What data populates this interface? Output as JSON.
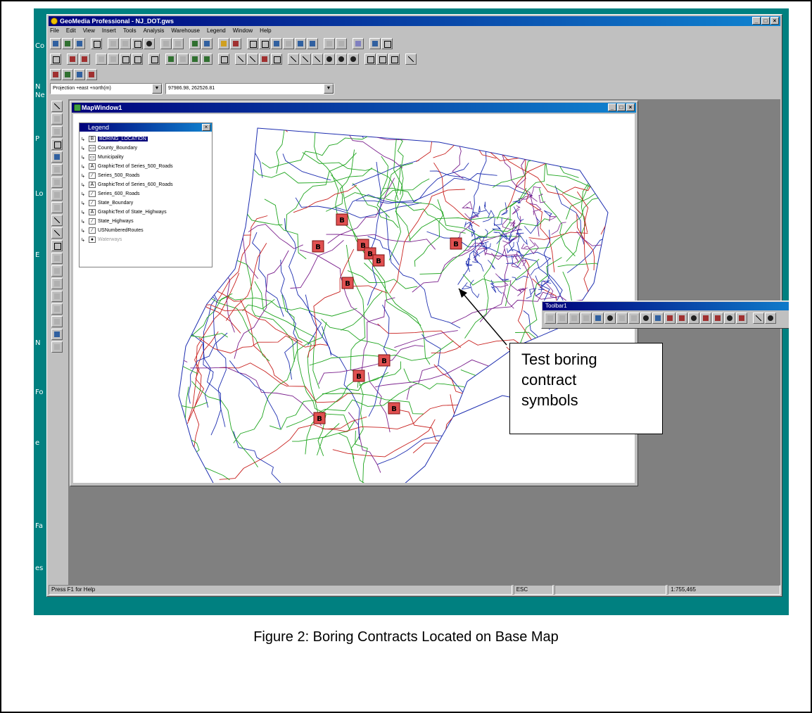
{
  "app": {
    "title": "GeoMedia Professional - NJ_DOT.gws",
    "menu": [
      "File",
      "Edit",
      "View",
      "Insert",
      "Tools",
      "Analysis",
      "Warehouse",
      "Legend",
      "Window",
      "Help"
    ],
    "projection_combo": "Projection +east +north(m)",
    "coordinate_combo": "97986.98, 262526.81",
    "status": {
      "help": "Press F1 for Help",
      "mode": "ESC",
      "scale": "1:755,465"
    }
  },
  "desktop_labels": [
    "Co",
    "N",
    "Ne",
    "P",
    "Lo",
    "E",
    "N",
    "Fo",
    "e",
    "Fa",
    "es"
  ],
  "map_window": {
    "title": "MapWindow1"
  },
  "legend": {
    "title": "Legend",
    "items": [
      {
        "label": "BORING_LOCATION",
        "symbol": "B",
        "selected": true,
        "dim": false
      },
      {
        "label": "County_Boundary",
        "symbol": "▭",
        "selected": false,
        "dim": false
      },
      {
        "label": "Municipality",
        "symbol": "▭",
        "selected": false,
        "dim": false
      },
      {
        "label": "GraphicText of Series_500_Roads",
        "symbol": "A",
        "selected": false,
        "dim": false
      },
      {
        "label": "Series_500_Roads",
        "symbol": "∕",
        "selected": false,
        "dim": false
      },
      {
        "label": "GraphicText of Series_600_Roads",
        "symbol": "A",
        "selected": false,
        "dim": false
      },
      {
        "label": "Series_600_Roads",
        "symbol": "∕",
        "selected": false,
        "dim": false
      },
      {
        "label": "State_Boundary",
        "symbol": "∕",
        "selected": false,
        "dim": false
      },
      {
        "label": "GraphicText of State_Highways",
        "symbol": "A",
        "selected": false,
        "dim": false
      },
      {
        "label": "State_Highways",
        "symbol": "∕",
        "selected": false,
        "dim": false
      },
      {
        "label": "USNumberedRoutes",
        "symbol": "∕",
        "selected": false,
        "dim": false
      },
      {
        "label": "Waterways",
        "symbol": "●",
        "selected": false,
        "dim": true
      }
    ]
  },
  "toolbar1": {
    "title": "Toolbar1"
  },
  "boring_symbol_label": "B",
  "callout": {
    "lines": [
      "Test boring",
      "contract",
      "symbols"
    ]
  },
  "caption": "Figure 2: Boring Contracts Located on Base Map",
  "colors": {
    "desktop": "#008080",
    "title_active": "#00007b",
    "road_green": "#1fa51f",
    "road_purple": "#7a1f8c",
    "road_blue": "#1c2db0",
    "road_red": "#c8201e",
    "boring_symbol": "#e05050"
  }
}
